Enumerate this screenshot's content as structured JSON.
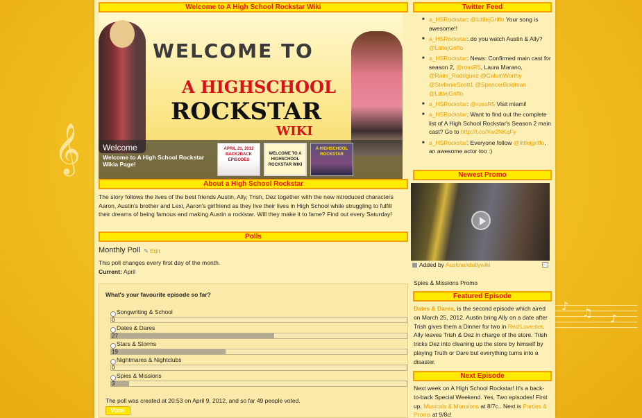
{
  "sections": {
    "welcome_header": "Welcome to A High School Rockstar Wiki",
    "about_header": "About a High School Rockstar",
    "polls_header": "Polls",
    "twitter_header": "Twitter Feed",
    "newest_promo_header": "Newest Promo",
    "featured_header": "Featured Episode",
    "next_header": "Next Episode"
  },
  "slider": {
    "banner_line1": "WELCOME TO",
    "banner_line2": "A HIGHSCHOOL",
    "banner_line3": "ROCKSTAR",
    "banner_line4": "WIKI",
    "caption_title": "Welcome",
    "caption_desc": "Welcome to A High School Rockstar Wikia Page!",
    "thumbs": [
      {
        "text": "APRIL 21, 2012 BACK2BACK EPISODES"
      },
      {
        "text": "WELCOME TO A HIGHSCHOOL ROCKSTAR WIKI"
      },
      {
        "text": "A HIGHSCHOOL ROCKSTAR"
      }
    ]
  },
  "about": {
    "text": "The story follows the lives of the best friends Austin, Ally, Trish, Dez together with the new introduced characters Aaron, Austin's brother and Lexi, Aaron's girlfriend as they live their lives in High School while struggling to fulfill their dreams of being famous and making Austin a rockstar. Will they make it to fame? Find out every Saturday!"
  },
  "poll": {
    "title": "Monthly Poll",
    "edit_label": "Edit",
    "desc": "This poll changes every first day of the month.",
    "current_label": "Current:",
    "current_value": "April",
    "question": "What's your favourite episode so far?",
    "options": [
      {
        "label": "Songwriting & School",
        "count": "0",
        "fraction": 0
      },
      {
        "label": "Dates & Dares",
        "count": "27",
        "fraction": 0.551
      },
      {
        "label": "Stars & Storms",
        "count": "19",
        "fraction": 0.3878
      },
      {
        "label": "Nightmares & Nightclubs",
        "count": "0",
        "fraction": 0
      },
      {
        "label": "Spies & Missions",
        "count": "3",
        "fraction": 0.0612
      }
    ],
    "footer": "The poll was created at 20:53 on April 9, 2012, and so far 49 people voted.",
    "vote_label": "Vote!"
  },
  "tweets": [
    {
      "user": "a_HSRockstar",
      "sep": ": ",
      "mention": "@LittlejGriffo",
      "text": " Your song is awesome!!"
    },
    {
      "user": "a_HSRockstar",
      "sep": ": do you watch Austin & Ally? ",
      "mention": "@LittlejGriffo",
      "text": ""
    },
    {
      "user": "a_HSRockstar",
      "sep": ": News: Confirmed main cast for season 2, ",
      "mention": "@rossR5",
      "text": ", Laura Marano, ",
      "extra": "@Raini_Rodriguez @CalumWorthy @StefanieScott1 @SpencerBoldman @LittlejGriffo"
    },
    {
      "user": "a_HSRockstar",
      "sep": ": ",
      "mention": "@rossR5",
      "text": " Visit miami!"
    },
    {
      "user": "a_HSRockstar",
      "sep": ": Want to find out the complete list of A High School Rockstar's Season 2 main cast? Go to ",
      "mention": "http://t.co/Xw2NKqFy",
      "text": ""
    },
    {
      "user": "a_HSRockstar",
      "sep": ": Everyone follow ",
      "mention": "@littlejgriffo",
      "text": ", an awesome actor too :)"
    }
  ],
  "promo": {
    "added_by_label": "Added by",
    "added_by_user": "Austinandallywiki",
    "title": "Spies & Missions Promo"
  },
  "featured": {
    "ep_link": "Dates & Dares",
    "text1": ", is the second episode which aired on March 25, 2012. Austin bring Ally on a date after Trish gives them a Dinner for two in ",
    "place_link": "Red Lovester",
    "text2": ". Ally leaves Trish & Dez in charge of the store. Trish tricks Dez into cleaning up the store by himself by playing Truth or Dare but everything turns into a disaster."
  },
  "next": {
    "text1": "Next week on A High School Rockstar! It's a back-to-back Special Weekend. Yes, Two episodes! First up, ",
    "link1": "Musicals & Mansions",
    "text2": " at 8/7c.. Next is ",
    "link2": "Parties & Proms",
    "text3": " at 9/8c!"
  },
  "colors": {
    "header_bg": "#ffea00",
    "header_text": "#e6141c",
    "link": "#e9a100",
    "page_bg": "#fdf0b6"
  },
  "icons": [
    "treble-clef-icon",
    "music-notes-icon",
    "pencil-icon",
    "play-icon",
    "video-icon",
    "popout-icon"
  ]
}
